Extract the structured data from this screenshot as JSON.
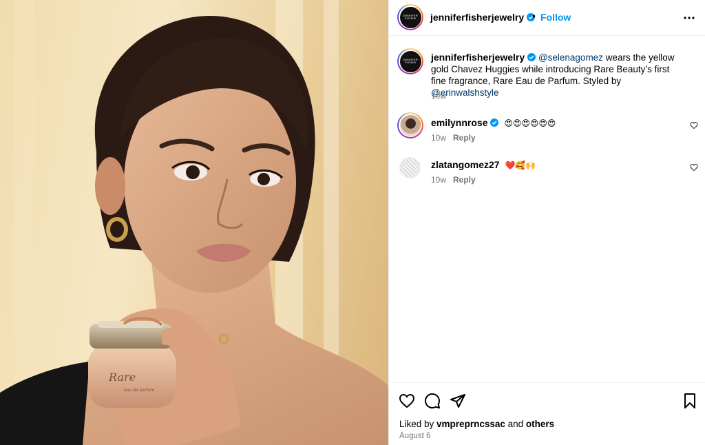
{
  "header": {
    "avatar_text": "JENNIFER FISHER",
    "username": "jenniferfisherjewelry",
    "separator": "•",
    "follow_label": "Follow"
  },
  "caption": {
    "username": "jenniferfisherjewelry",
    "mention1": "@selenagomez",
    "text1": " wears the yellow gold Chavez Huggies while introducing Rare Beauty’s first fine fragrance, Rare Eau de Parfum. Styled by ",
    "mention2": "@erinwalshstyle",
    "time": "10w"
  },
  "comments": [
    {
      "username": "emilynnrose",
      "text": "😍😍😍😍😍😍",
      "time": "10w",
      "reply_label": "Reply"
    },
    {
      "username": "zlatangomez27",
      "text": "❤️🥰🙌",
      "time": "10w",
      "reply_label": "Reply"
    }
  ],
  "footer": {
    "liked_prefix": "Liked by ",
    "liked_user": "vmpreprncssac",
    "liked_and": " and ",
    "liked_others": "others",
    "date": "August 6"
  },
  "photo": {
    "bottle_brand": "Rare",
    "bottle_sub": "eau de parfum"
  },
  "colors": {
    "link": "#0095f6",
    "verified": "#0095f6",
    "mention": "#00376b"
  }
}
